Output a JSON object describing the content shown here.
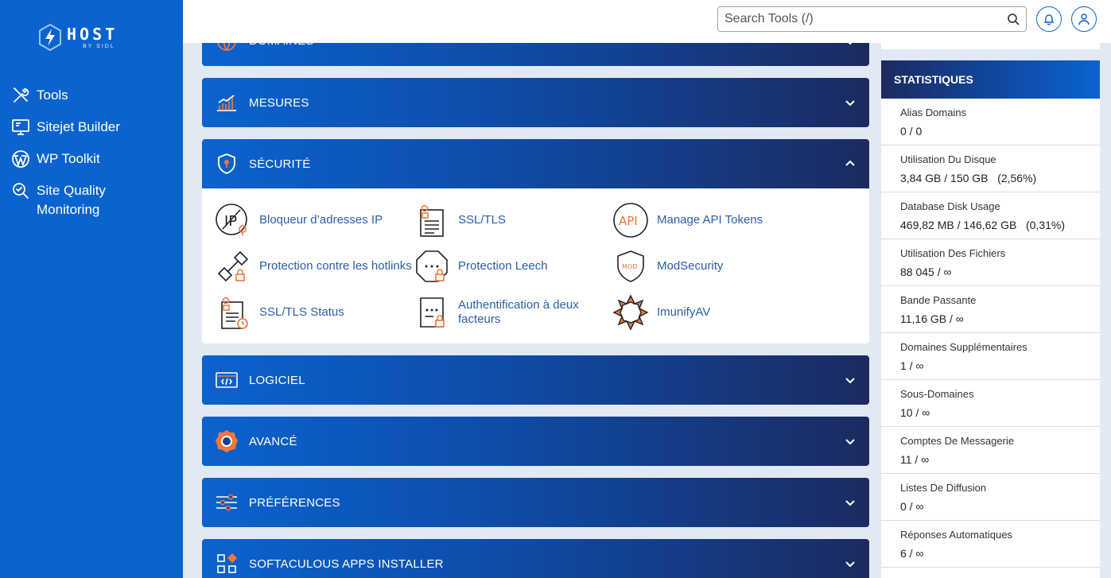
{
  "brand": {
    "name": "HOST",
    "sub": "BY SIDL"
  },
  "sidebar": {
    "items": [
      {
        "label": "Tools",
        "icon": "tools-icon"
      },
      {
        "label": "Sitejet Builder",
        "icon": "monitor-icon"
      },
      {
        "label": "WP Toolkit",
        "icon": "wordpress-icon"
      },
      {
        "label": "Site Quality Monitoring",
        "icon": "magnifier-check-icon"
      }
    ]
  },
  "topbar": {
    "search_placeholder": "Search Tools (/)"
  },
  "panels": {
    "domaines": "DOMAINES",
    "mesures": "MESURES",
    "securite": "SÉCURITÉ",
    "logiciel": "LOGICIEL",
    "avance": "AVANCÉ",
    "preferences": "PRÉFÉRENCES",
    "softaculous": "SOFTACULOUS APPS INSTALLER"
  },
  "security_tools": [
    {
      "label": "Bloqueur d’adresses IP"
    },
    {
      "label": "SSL/TLS"
    },
    {
      "label": "Manage API Tokens"
    },
    {
      "label": "Protection contre les hotlinks"
    },
    {
      "label": "Protection Leech"
    },
    {
      "label": "ModSecurity"
    },
    {
      "label": "SSL/TLS Status"
    },
    {
      "label": "Authentification à deux facteurs"
    },
    {
      "label": "ImunifyAV"
    }
  ],
  "icon_text": {
    "ip": "IP",
    "api": "API",
    "mod": "MOD"
  },
  "stats": {
    "title": "STATISTIQUES",
    "items": [
      {
        "label": "Alias Domains",
        "value": "0 / 0"
      },
      {
        "label": "Utilisation Du Disque",
        "value": "3,84 GB / 150 GB   (2,56%)"
      },
      {
        "label": "Database Disk Usage",
        "value": "469,82 MB / 146,62 GB   (0,31%)"
      },
      {
        "label": "Utilisation Des Fichiers",
        "value": "88 045 / ∞"
      },
      {
        "label": "Bande Passante",
        "value": "11,16 GB / ∞"
      },
      {
        "label": "Domaines Supplémentaires",
        "value": "1 / ∞"
      },
      {
        "label": "Sous-Domaines",
        "value": "10 / ∞"
      },
      {
        "label": "Comptes De Messagerie",
        "value": "11 / ∞"
      },
      {
        "label": "Listes De Diffusion",
        "value": "0 / ∞"
      },
      {
        "label": "Réponses Automatiques",
        "value": "6 / ∞"
      }
    ]
  },
  "colors": {
    "primary": "#0b63cf",
    "dark": "#1c2a60",
    "accent": "#f0773a",
    "link": "#2b5ea8"
  }
}
